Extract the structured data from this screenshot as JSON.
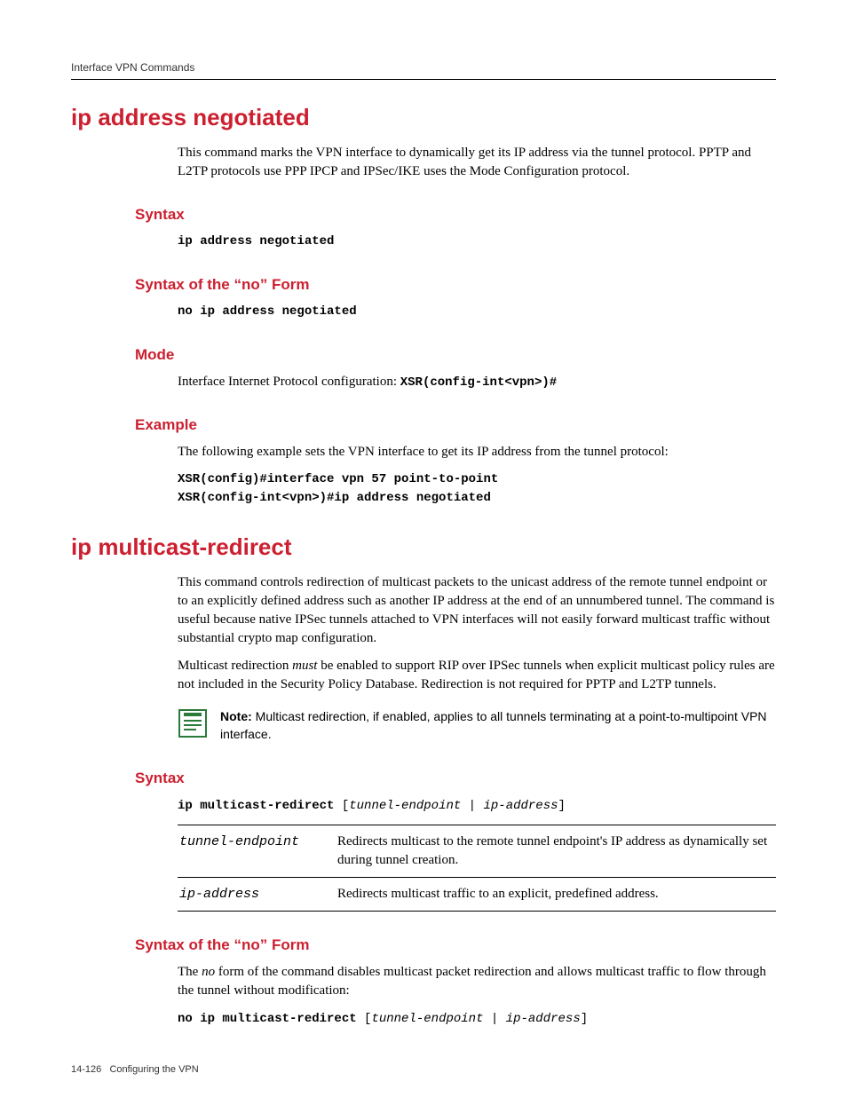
{
  "header": {
    "running": "Interface VPN Commands"
  },
  "sec1": {
    "title": "ip address negotiated",
    "intro": "This command marks the VPN interface to dynamically get its IP address via the tunnel protocol. PPTP and L2TP protocols use PPP IPCP and IPSec/IKE uses the Mode Configuration protocol.",
    "syntax_h": "Syntax",
    "syntax_cmd": "ip address negotiated",
    "noform_h": "Syntax of the “no” Form",
    "noform_cmd": "no ip address negotiated",
    "mode_h": "Mode",
    "mode_text": "Interface Internet Protocol configuration: ",
    "mode_prompt": "XSR(config-int<vpn>)#",
    "example_h": "Example",
    "example_text": "The following example sets the VPN interface to get its IP address from the tunnel protocol:",
    "example_code1": "XSR(config)#interface vpn 57 point-to-point",
    "example_code2": "XSR(config-int<vpn>)#ip address negotiated"
  },
  "sec2": {
    "title": "ip multicast-redirect",
    "intro1": "This command controls redirection of multicast packets to the unicast address of the remote tunnel endpoint or to an explicitly defined address such as another IP address at the end of an unnumbered tunnel. The command is useful because native IPSec tunnels attached to VPN interfaces will not easily forward multicast traffic without substantial crypto map configuration.",
    "intro2_a": "Multicast redirection ",
    "intro2_em": "must",
    "intro2_b": " be enabled to support RIP over IPSec tunnels when explicit multicast policy rules are not included in the Security Policy Database. Redirection is not required for PPTP and L2TP tunnels.",
    "note_label": "Note:",
    "note_text": " Multicast redirection, if enabled, applies to all tunnels terminating at a point-to-multipoint VPN interface.",
    "syntax_h": "Syntax",
    "syntax_cmd": "ip multicast-redirect",
    "syntax_opt_open": " [",
    "syntax_opt_a": "tunnel-endpoint",
    "syntax_opt_sep": " | ",
    "syntax_opt_b": "ip-address",
    "syntax_opt_close": "]",
    "params": [
      {
        "name": "tunnel-endpoint",
        "desc": "Redirects multicast to the remote tunnel endpoint's IP address as dynamically set during tunnel creation."
      },
      {
        "name": "ip-address",
        "desc": "Redirects multicast traffic to an explicit, predefined address."
      }
    ],
    "noform_h": "Syntax of the “no” Form",
    "noform_text_a": "The ",
    "noform_text_em": "no",
    "noform_text_b": " form of the command disables multicast packet redirection and allows multicast traffic to flow through the tunnel without modification:",
    "noform_cmd": "no ip multicast-redirect"
  },
  "footer": {
    "pagenum": "14-126",
    "title": "Configuring the VPN"
  }
}
